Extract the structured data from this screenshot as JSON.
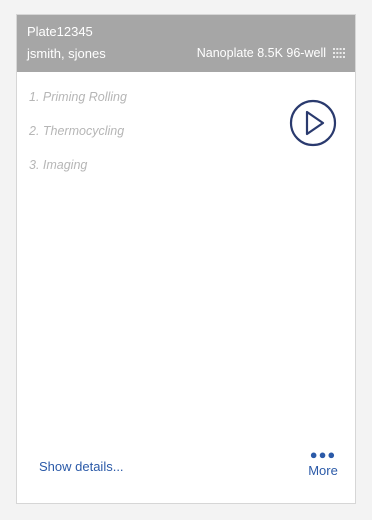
{
  "card": {
    "plate_name": "Plate12345",
    "users": "jsmith, sjones",
    "plate_type": "Nanoplate 8.5K 96-well",
    "plate_type_icon": "grid-icon",
    "steps": [
      "1. Priming Rolling",
      "2. Thermocycling",
      "3. Imaging"
    ],
    "play_icon": "play-circle-icon",
    "show_details_label": "Show details...",
    "more_icon": "more-dots-icon",
    "more_label": "More"
  },
  "colors": {
    "header_bg": "#a6a6a6",
    "header_text": "#ffffff",
    "step_text": "#b6b6b6",
    "link": "#2b5aa8",
    "play_icon": "#2a3a6e"
  }
}
